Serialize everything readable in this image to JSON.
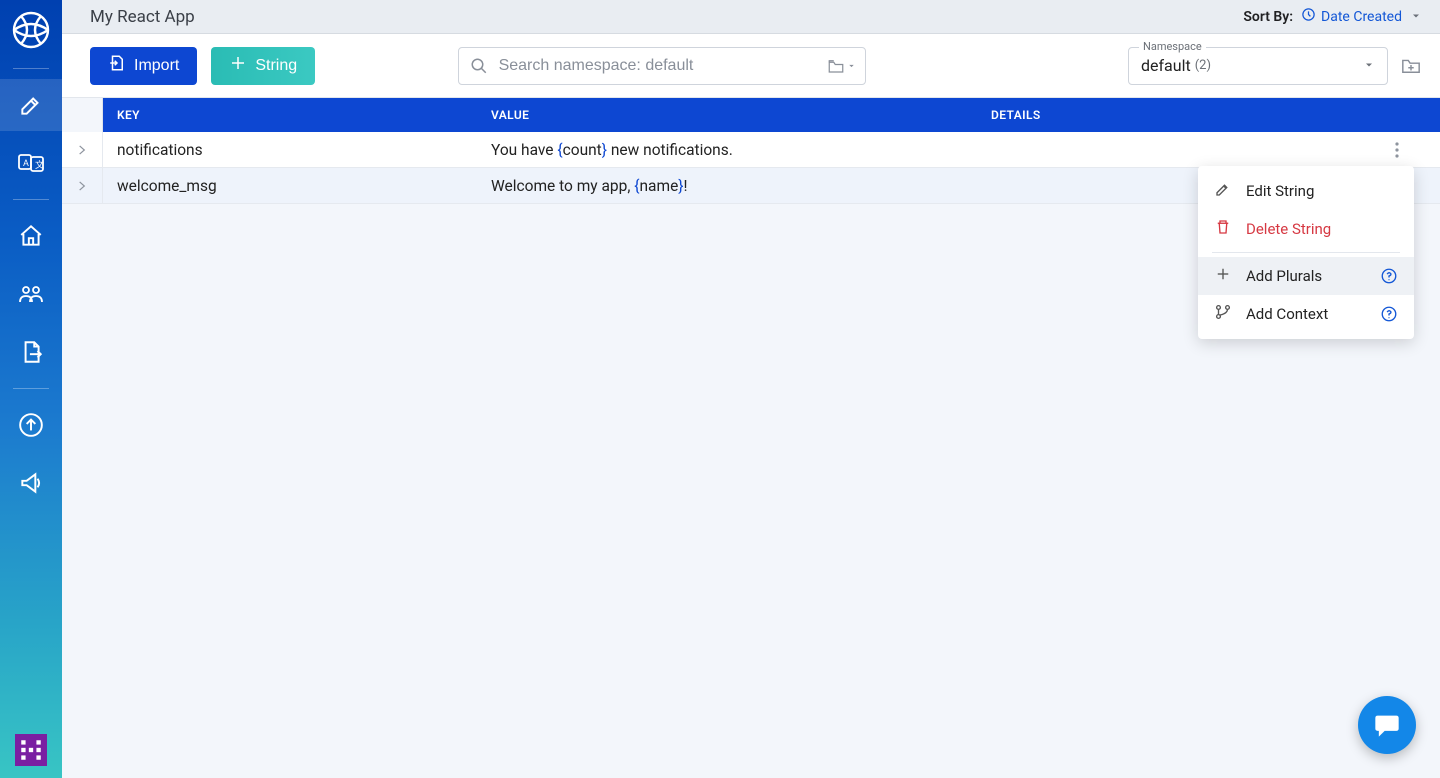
{
  "header": {
    "title": "My React App",
    "sort_label": "Sort By:",
    "sort_value": "Date Created"
  },
  "toolbar": {
    "import_label": "Import",
    "string_label": "String",
    "search_placeholder": "Search namespace: default",
    "namespace_legend": "Namespace",
    "namespace_value": "default",
    "namespace_count": "(2)"
  },
  "table": {
    "columns": {
      "key": "KEY",
      "value": "VALUE",
      "details": "DETAILS"
    },
    "rows": [
      {
        "key": "notifications",
        "value": {
          "pre": "You have ",
          "brace_open": "{",
          "token": "count",
          "brace_close": "}",
          "post": " new notifications."
        }
      },
      {
        "key": "welcome_msg",
        "value": {
          "pre": "Welcome to my app, ",
          "brace_open": "{",
          "token": "name",
          "brace_close": "}",
          "post": "!"
        }
      }
    ]
  },
  "menu": {
    "edit": "Edit String",
    "delete": "Delete String",
    "plurals": "Add Plurals",
    "context": "Add Context"
  }
}
